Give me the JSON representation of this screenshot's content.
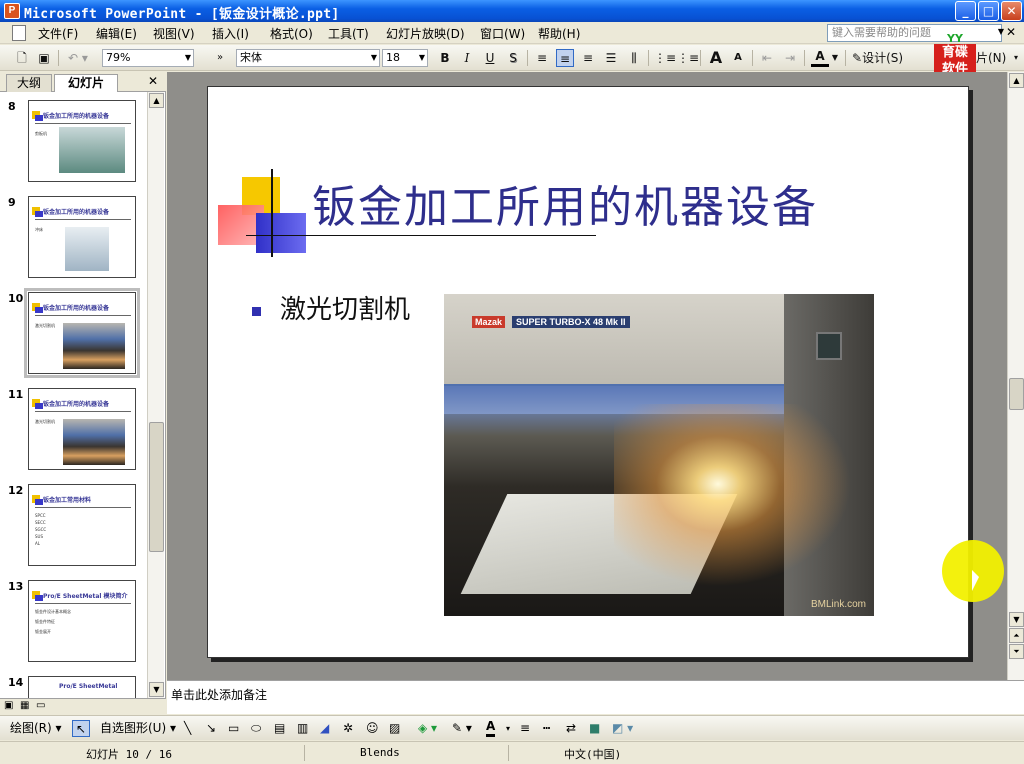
{
  "window": {
    "title": "Microsoft PowerPoint - [钣金设计概论.ppt]",
    "app_icon": "P",
    "minimize": "_",
    "maximize": "□",
    "close": "✕"
  },
  "menu": {
    "items": [
      "文件(F)",
      "编辑(E)",
      "视图(V)",
      "插入(I)",
      "格式(O)",
      "工具(T)",
      "幻灯片放映(D)",
      "窗口(W)",
      "帮助(H)"
    ],
    "help_placeholder": "键入需要帮助的问题",
    "doc_close": "✕"
  },
  "toolbar": {
    "zoom": "79%",
    "font_name": "宋体",
    "font_size": "18",
    "bold": "B",
    "italic": "I",
    "underline": "U",
    "shadow": "S",
    "grow": "A",
    "shrink": "A",
    "font_color": "A",
    "design": "设计(S)",
    "new_slide": "片(N)"
  },
  "logo": {
    "top": "YY",
    "line1": "育碟",
    "line2": "软件",
    "color": "#D6201C"
  },
  "left_panel": {
    "tabs": [
      "大纲",
      "幻灯片"
    ],
    "active_tab": "幻灯片",
    "close": "✕",
    "slides": [
      {
        "num": "8",
        "title": "钣金加工所用的机器设备",
        "bullets": [
          "剪板机"
        ]
      },
      {
        "num": "9",
        "title": "钣金加工所用的机器设备",
        "bullets": [
          "冲床"
        ]
      },
      {
        "num": "10",
        "title": "钣金加工所用的机器设备",
        "bullets": [
          "激光切割机"
        ]
      },
      {
        "num": "11",
        "title": "钣金加工所用的机器设备",
        "bullets": [
          "激光切割机"
        ]
      },
      {
        "num": "12",
        "title": "钣金加工常用材料",
        "bullets": [
          "SPCC",
          "SECC",
          "SGCC",
          "SUS",
          "AL"
        ]
      },
      {
        "num": "13",
        "title": "Pro/E SheetMetal 模块简介",
        "bullets": [
          "钣金件设计基本概念",
          "钣金件特征",
          "钣金展开"
        ]
      },
      {
        "num": "14",
        "title": "Pro/E SheetMetal",
        "bullets": []
      }
    ]
  },
  "slide": {
    "title": "钣金加工所用的机器设备",
    "bullet": "激光切割机",
    "photo": {
      "brand": "Mazak",
      "model": "SUPER TURBO-X 48 Mk II",
      "watermark": "BMLink.com"
    },
    "colors": {
      "title": "#2E2E8C",
      "bullet": "#3030B0",
      "deco_yellow": "#F6C800",
      "deco_red": "#FF5050",
      "deco_blue": "#3030C8"
    }
  },
  "notes": {
    "placeholder": "单击此处添加备注"
  },
  "drawbar": {
    "draw": "绘图(R)",
    "autoshapes": "自选图形(U)"
  },
  "status": {
    "slide": "幻灯片 10 / 16",
    "template": "Blends",
    "language": "中文(中国)"
  }
}
